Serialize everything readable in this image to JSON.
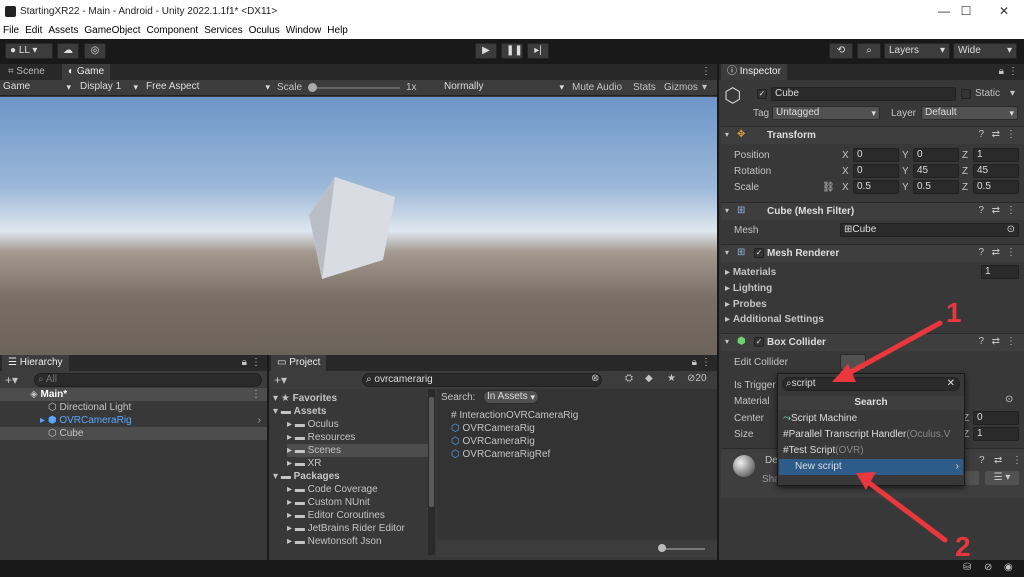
{
  "window": {
    "title": "StartingXR22 - Main - Android - Unity 2022.1.1f1* <DX11>",
    "min": "—",
    "max": "☐",
    "close": "✕"
  },
  "menu": [
    "File",
    "Edit",
    "Assets",
    "GameObject",
    "Component",
    "Services",
    "Oculus",
    "Window",
    "Help"
  ],
  "toolbar": {
    "account": "LL",
    "layers": "Layers",
    "layout": "Wide"
  },
  "scene_tabs": {
    "scene": "Scene",
    "game": "Game"
  },
  "game_bar": {
    "display_mode": "Game",
    "display": "Display 1",
    "aspect": "Free Aspect",
    "scale_label": "Scale",
    "scale_value": "1x",
    "quality": "Normally",
    "mute": "Mute Audio",
    "stats": "Stats",
    "gizmos": "Gizmos"
  },
  "hierarchy": {
    "tab": "Hierarchy",
    "search_placeholder": "All",
    "items": [
      {
        "label": "Main*",
        "color": "#ffffff"
      },
      {
        "label": "Directional Light",
        "color": "#c4c4c4"
      },
      {
        "label": "OVRCameraRig",
        "color": "#5aa6ff"
      },
      {
        "label": "Cube",
        "color": "#c4c4c4"
      }
    ]
  },
  "project": {
    "tab": "Project",
    "search": "ovrcamerarig",
    "count": "20",
    "search_label": "Search:",
    "search_scope": "In Assets",
    "tree": [
      {
        "label": "Favorites",
        "bold": true,
        "indent": 0
      },
      {
        "label": "Assets",
        "bold": true,
        "indent": 0
      },
      {
        "label": "Oculus",
        "bold": false,
        "indent": 1
      },
      {
        "label": "Resources",
        "bold": false,
        "indent": 1
      },
      {
        "label": "Scenes",
        "bold": false,
        "indent": 1
      },
      {
        "label": "XR",
        "bold": false,
        "indent": 1
      },
      {
        "label": "Packages",
        "bold": true,
        "indent": 0
      },
      {
        "label": "Code Coverage",
        "bold": false,
        "indent": 1
      },
      {
        "label": "Custom NUnit",
        "bold": false,
        "indent": 1
      },
      {
        "label": "Editor Coroutines",
        "bold": false,
        "indent": 1
      },
      {
        "label": "JetBrains Rider Editor",
        "bold": false,
        "indent": 1
      },
      {
        "label": "Newtonsoft Json",
        "bold": false,
        "indent": 1
      }
    ],
    "results": [
      "InteractionOVRCameraRig",
      "OVRCameraRig",
      "OVRCameraRig",
      "OVRCameraRigRef"
    ]
  },
  "inspector": {
    "tab": "Inspector",
    "object_name": "Cube",
    "static_label": "Static",
    "tag_label": "Tag",
    "tag_value": "Untagged",
    "layer_label": "Layer",
    "layer_value": "Default",
    "transform": {
      "name": "Transform",
      "rows": [
        {
          "label": "Position",
          "x": "0",
          "y": "0",
          "z": "1"
        },
        {
          "label": "Rotation",
          "x": "0",
          "y": "45",
          "z": "45"
        },
        {
          "label": "Scale",
          "x": "0.5",
          "y": "0.5",
          "z": "0.5"
        }
      ],
      "axis_x": "X",
      "axis_y": "Y",
      "axis_z": "Z"
    },
    "mesh_filter": {
      "name": "Cube (Mesh Filter)",
      "mesh_label": "Mesh",
      "mesh_value": "Cube"
    },
    "mesh_renderer": {
      "name": "Mesh Renderer",
      "materials": "Materials",
      "materials_count": "1",
      "lighting": "Lighting",
      "probes": "Probes",
      "additional": "Additional Settings"
    },
    "box_collider": {
      "name": "Box Collider",
      "edit": "Edit Collider",
      "is_trigger": "Is Trigger",
      "material": "Material",
      "center": "Center",
      "size": "Size",
      "center_z": "0",
      "size_z": "1"
    },
    "material_preview": {
      "name_start": "De",
      "shader_start": "Sha"
    }
  },
  "popup": {
    "search_value": "script",
    "header": "Search",
    "items": [
      {
        "label": "Script Machine",
        "suffix": "",
        "icon": "script-machine-icon"
      },
      {
        "label": "Parallel Transcript Handler",
        "suffix": "(Oculus.V",
        "icon": "csharp-icon"
      },
      {
        "label": "Test Script",
        "suffix": "(OVR)",
        "icon": "csharp-icon"
      },
      {
        "label": "New script",
        "suffix": "",
        "icon": ""
      }
    ]
  },
  "annotations": {
    "one": "1",
    "two": "2"
  },
  "colors": {
    "accent": "#2c5d87",
    "annotation": "#e8383d",
    "selected_item": "#2d5b8a"
  }
}
